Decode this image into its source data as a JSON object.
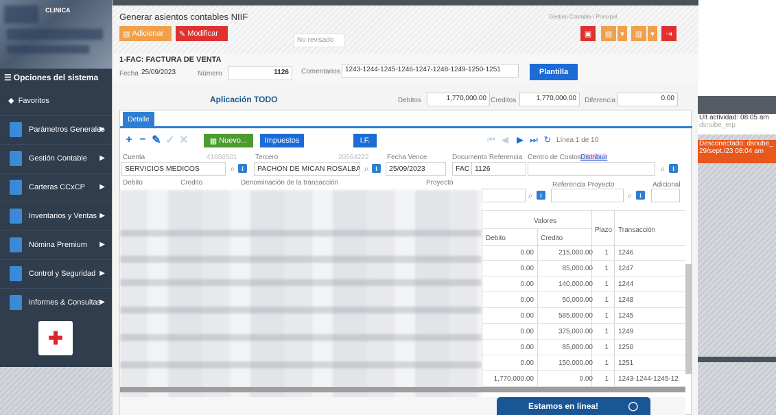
{
  "sidebar": {
    "clinic_name": "CLINICA",
    "system_title": "Opciones del sistema",
    "favorites": "Favoritos",
    "menu": [
      {
        "label": "Parámetros Generales"
      },
      {
        "label": "Gestión Contable"
      },
      {
        "label": "Carteras CCxCP"
      },
      {
        "label": "Inventarios y Ventas"
      },
      {
        "label": "Nómina Premium"
      },
      {
        "label": "Control y Seguridad"
      },
      {
        "label": "Informes & Consultas"
      }
    ],
    "caret": "▶",
    "icon_color": "#3d88d8"
  },
  "header": {
    "title": "Generar asientos contables NIIF",
    "breadcrumb": "Gestión Contable / Principal",
    "add_label": "Adicionar",
    "edit_label": "Modificar",
    "review_status": "No revisado"
  },
  "document": {
    "type": "1-FAC: FACTURA DE VENTA",
    "date_label": "Fecha",
    "date": "25/09/2023",
    "number_label": "Número",
    "number": "1126",
    "comments_label": "Comentarios",
    "comments": "1243-1244-1245-1246-1247-1248-1249-1250-1251",
    "template_button": "Plantilla",
    "application_title": "Aplicación TODO",
    "debits_label": "Debitos",
    "debits": "1,770,000.00",
    "credits_label": "Creditos",
    "credits": "1,770,000.00",
    "difference_label": "Diferencia",
    "difference": "0.00"
  },
  "detail": {
    "tab": "Detalle",
    "new_button": "Nuevo...",
    "taxes_button": "Impuestos",
    "if_button": "I.F.",
    "line_info": "Línea 1 de 10",
    "account_label": "Cuenta",
    "account_code": "41650501",
    "account_name": "SERVICIOS MEDICOS",
    "third_label": "Tercero",
    "third_code": "20564222",
    "third_name": "PACHON DE MICAN ROSALBA",
    "due_date_label": "Fecha Vence",
    "due_date": "25/09/2023",
    "ref_doc_label": "Documento Referencia",
    "ref_doc_type": "FAC",
    "ref_doc_number": "1126",
    "cost_center_label": "Centro de Costos",
    "distribute_link": "Distribuir",
    "debit_label": "Debito",
    "credit_label": "Credito",
    "description_label": "Denominación de la transacción",
    "project_label": "Proyecto",
    "project_ref_label": "Referencia Proyecto",
    "additional_label": "Adicional"
  },
  "table": {
    "group_header": "Valores",
    "columns": [
      "Debito",
      "Credito",
      "Plazo",
      "Transacción"
    ],
    "rows": [
      {
        "debit": "0.00",
        "credit": "215,000.00",
        "term": "1",
        "transaction": "1246"
      },
      {
        "debit": "0.00",
        "credit": "85,000.00",
        "term": "1",
        "transaction": "1247"
      },
      {
        "debit": "0.00",
        "credit": "140,000.00",
        "term": "1",
        "transaction": "1244"
      },
      {
        "debit": "0.00",
        "credit": "50,000.00",
        "term": "1",
        "transaction": "1248"
      },
      {
        "debit": "0.00",
        "credit": "585,000.00",
        "term": "1",
        "transaction": "1245"
      },
      {
        "debit": "0.00",
        "credit": "375,000.00",
        "term": "1",
        "transaction": "1249"
      },
      {
        "debit": "0.00",
        "credit": "85,000.00",
        "term": "1",
        "transaction": "1250"
      },
      {
        "debit": "0.00",
        "credit": "150,000.00",
        "term": "1",
        "transaction": "1251"
      },
      {
        "debit": "1,770,000.00",
        "credit": "0.00",
        "term": "1",
        "transaction": "1243-1244-1245-12"
      }
    ]
  },
  "status": {
    "last_activity": "Ult actividad: 08:05 am",
    "user": "dsnube_erp",
    "disconnected": "Desconectado: dsnube_",
    "disconnected_date": "29/sept./23 08:04 am"
  },
  "chat": {
    "label": "Estamos en línea!"
  },
  "colors": {
    "sidebar_bg": "#2f3d4c",
    "accent_blue": "#2c7fd3",
    "btn_orange": "#f0a04b",
    "btn_red": "#e03131",
    "btn_green": "#4b9b2e",
    "disconnect_orange": "#e8571c",
    "chat_blue": "#1a5596"
  }
}
